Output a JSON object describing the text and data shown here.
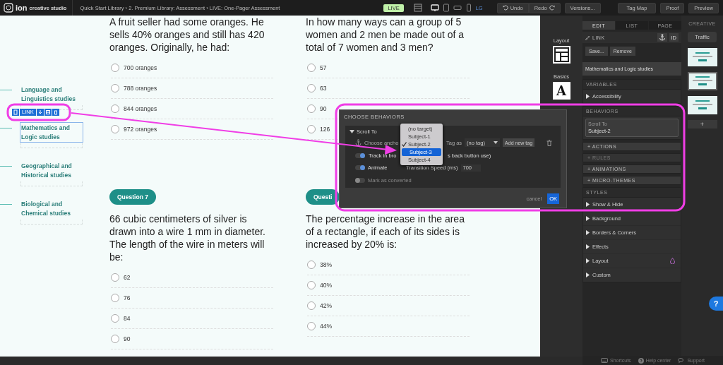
{
  "topbar": {
    "logo": "ion",
    "logo_sub": "creative studio",
    "breadcrumb": "Quick Start Library › 2. Premium Library: Assessment › LIVE: One-Pager Assessment",
    "status": "LIVE",
    "devices": [
      {
        "kind": "desktop",
        "selected": true
      },
      {
        "kind": "tablet",
        "selected": false
      },
      {
        "kind": "landscape",
        "selected": false
      },
      {
        "kind": "phone",
        "selected": false
      }
    ],
    "device_size": "LG",
    "buttons": [
      {
        "kind": "undo",
        "label": "Undo"
      },
      {
        "kind": "redo",
        "label": "Redo"
      },
      {
        "kind": "versions",
        "label": "Versions..."
      },
      {
        "kind": "tagmap",
        "label": "Tag Map"
      },
      {
        "kind": "proof",
        "label": "Proof"
      },
      {
        "kind": "preview",
        "label": "Preview"
      }
    ]
  },
  "nav": {
    "items": [
      {
        "label": "Language and Linguistics studies",
        "selected": false
      },
      {
        "label": "Mathematics and Logic studies",
        "selected": true
      },
      {
        "label": "Geographical and Historical studies",
        "selected": false
      },
      {
        "label": "Biological and Chemical studies",
        "selected": false
      }
    ],
    "toolbar_label": "LINK"
  },
  "columns": [
    [
      {
        "text": "A fruit seller had some oranges. He sells 40% oranges and still has 420 oranges. Originally, he had:",
        "options": [
          {
            "label": "700 oranges",
            "selected": false
          },
          {
            "label": "788 oranges",
            "selected": false
          },
          {
            "label": "844 oranges",
            "selected": false
          },
          {
            "label": "972 oranges",
            "selected": false
          }
        ]
      },
      {
        "badge": "Question 7",
        "text": "66 cubic centimeters of silver is drawn into a wire 1 mm in diameter. The length of the wire in meters will be:",
        "options": [
          {
            "label": "62",
            "selected": false
          },
          {
            "label": "76",
            "selected": false
          },
          {
            "label": "84",
            "selected": false
          },
          {
            "label": "90",
            "selected": false
          }
        ]
      }
    ],
    [
      {
        "text": "In how many ways can a group of 5 women and 2 men be made out of a total of 7 women and 3 men?",
        "options": [
          {
            "label": "57",
            "selected": false
          },
          {
            "label": "63",
            "selected": false
          },
          {
            "label": "90",
            "selected": false
          },
          {
            "label": "126",
            "selected": false
          }
        ]
      },
      {
        "badge": "Questi",
        "text": "The percentage increase in the area of a rectangle, if each of its sides is increased by 20% is:",
        "options": [
          {
            "label": "38%",
            "selected": false
          },
          {
            "label": "40%",
            "selected": false
          },
          {
            "label": "42%",
            "selected": false
          },
          {
            "label": "44%",
            "selected": false
          }
        ]
      }
    ]
  ],
  "dialog": {
    "title": "CHOOSE BEHAVIORS",
    "section": "Scroll To",
    "anchor_label": "Choose ancho",
    "anchor_options": [
      {
        "label": "(no target)",
        "checked": false,
        "highlighted": false
      },
      {
        "label": "Subject-1",
        "checked": false,
        "highlighted": false
      },
      {
        "label": "Subject-2",
        "checked": true,
        "highlighted": false
      },
      {
        "label": "Subject-3",
        "checked": false,
        "highlighted": true
      },
      {
        "label": "Subject-4",
        "checked": false,
        "highlighted": false
      }
    ],
    "tag_label": "Tag as",
    "tag_value": "(no tag)",
    "add_tag": "Add new tag",
    "toggles": [
      {
        "label": "Track in bro",
        "label_tail": "s back button use)",
        "on": true
      },
      {
        "label": "Animate",
        "on": true,
        "speed_label": "Transition Speed (ms)",
        "speed_value": "700"
      },
      {
        "label": "Mark as converted",
        "on": false
      }
    ],
    "cancel": "cancel",
    "ok": "OK"
  },
  "tools": [
    {
      "label": "Layout",
      "kind": "layout"
    },
    {
      "label": "Basics",
      "kind": "basics",
      "glyph": "A"
    }
  ],
  "inspector": {
    "tabs": [
      {
        "label": "EDIT",
        "selected": true
      },
      {
        "label": "LIST",
        "selected": false
      },
      {
        "label": "PAGE",
        "selected": false
      }
    ],
    "element_type": "LINK",
    "id_button": "ID",
    "save": "Save...",
    "remove": "Remove",
    "name": "Mathematics and Logic studies",
    "variables_title": "VARIABLES",
    "variables": [
      "Accessibility"
    ],
    "behaviors_title": "BEHAVIORS",
    "behavior": {
      "type": "Scroll To",
      "target": "Subject-2"
    },
    "collapsibles": [
      {
        "label": "+ ACTIONS",
        "disabled": false
      },
      {
        "label": "+ RULES",
        "disabled": true
      },
      {
        "label": "+ ANIMATIONS",
        "disabled": false
      },
      {
        "label": "+ MICRO-THEMES",
        "disabled": false
      }
    ],
    "styles_title": "STYLES",
    "styles": [
      {
        "label": "Show & Hide",
        "flag": false
      },
      {
        "label": "Background",
        "flag": false
      },
      {
        "label": "Borders & Corners",
        "flag": false
      },
      {
        "label": "Effects",
        "flag": false
      },
      {
        "label": "Layout",
        "flag": true
      },
      {
        "label": "Custom",
        "flag": false
      }
    ]
  },
  "creative": {
    "tab": "CREATIVE",
    "traffic": "Traffic",
    "pages": [
      {
        "selected": false
      },
      {
        "selected": true
      },
      {
        "selected": false
      }
    ],
    "add": "+"
  },
  "footer": [
    {
      "kind": "shortcuts",
      "label": "Shortcuts"
    },
    {
      "kind": "help",
      "label": "Help center"
    },
    {
      "kind": "support",
      "label": "Support"
    }
  ],
  "help": "?"
}
